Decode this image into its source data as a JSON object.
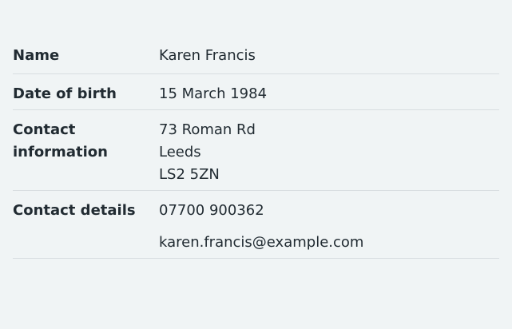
{
  "summary": {
    "rows": [
      {
        "key": "Name",
        "value": [
          "Karen Francis"
        ]
      },
      {
        "key": "Date of birth",
        "value": [
          "15 March 1984"
        ]
      },
      {
        "key_lines": [
          "Contact",
          "information"
        ],
        "value": [
          "73 Roman Rd",
          "Leeds",
          "LS2 5ZN"
        ]
      },
      {
        "key": "Contact details",
        "value": [
          "07700 900362",
          "karen.francis@example.com"
        ]
      }
    ]
  }
}
